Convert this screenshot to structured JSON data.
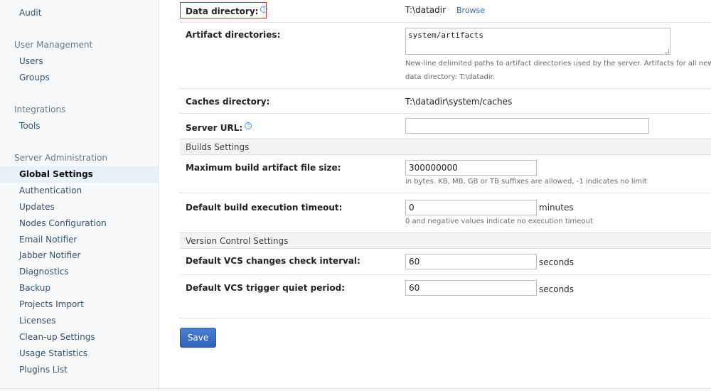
{
  "sidebar": {
    "audit": "Audit",
    "user_management": {
      "heading": "User Management",
      "items": [
        "Users",
        "Groups"
      ]
    },
    "integrations": {
      "heading": "Integrations",
      "items": [
        "Tools"
      ]
    },
    "server_administration": {
      "heading": "Server Administration",
      "active": "Global Settings",
      "items": [
        "Authentication",
        "Updates",
        "Nodes Configuration",
        "Email Notifier",
        "Jabber Notifier",
        "Diagnostics",
        "Backup",
        "Projects Import",
        "Licenses",
        "Clean-up Settings",
        "Usage Statistics",
        "Plugins List"
      ]
    }
  },
  "form": {
    "data_directory": {
      "label": "Data directory:",
      "value": "T:\\datadir",
      "browse": "Browse",
      "help_icon": "question-circle-icon"
    },
    "artifact_directories": {
      "label": "Artifact directories:",
      "value": "system/artifacts",
      "note_line1": "New-line delimited paths to artifact directories used by the server. Artifacts for all new bui",
      "note_line2": "data directory: T:\\datadir."
    },
    "caches_directory": {
      "label": "Caches directory:",
      "value": "T:\\datadir\\system/caches"
    },
    "server_url": {
      "label": "Server URL:",
      "value": ""
    },
    "builds_section": "Builds Settings",
    "max_artifact_size": {
      "label": "Maximum build artifact file size:",
      "value": "300000000",
      "note": "in bytes. KB, MB, GB or TB suffixes are allowed, -1 indicates no limit"
    },
    "build_timeout": {
      "label": "Default build execution timeout:",
      "value": "0",
      "unit": "minutes",
      "note": "0 and negative values indicate no execution timeout"
    },
    "vcs_section": "Version Control Settings",
    "vcs_check_interval": {
      "label": "Default VCS changes check interval:",
      "value": "60",
      "unit": "seconds"
    },
    "vcs_quiet_period": {
      "label": "Default VCS trigger quiet period:",
      "value": "60",
      "unit": "seconds"
    },
    "save_label": "Save"
  },
  "colors": {
    "accent": "#3a6da8",
    "highlight_border": "#c43a3a",
    "save_button": "#3a6fc4"
  }
}
